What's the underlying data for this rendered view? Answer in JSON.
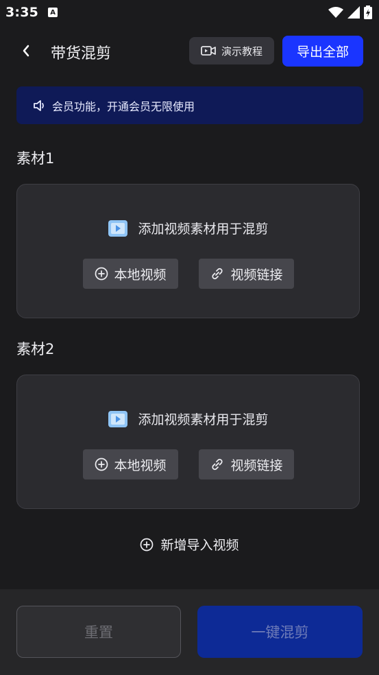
{
  "status_bar": {
    "time": "3:35",
    "notification_icon": "a-icon"
  },
  "header": {
    "title": "带货混剪",
    "tutorial_label": "演示教程",
    "export_label": "导出全部"
  },
  "vip_banner": {
    "text": "会员功能，开通会员无限使用"
  },
  "materials": [
    {
      "label": "素材1",
      "hint": "添加视频素材用于混剪",
      "local_label": "本地视频",
      "link_label": "视频链接"
    },
    {
      "label": "素材2",
      "hint": "添加视频素材用于混剪",
      "local_label": "本地视频",
      "link_label": "视频链接"
    }
  ],
  "add_video_label": "新增导入视频",
  "footer": {
    "reset_label": "重置",
    "mix_label": "一键混剪"
  },
  "colors": {
    "accent": "#1a35ff",
    "banner": "#0f1a57",
    "disabled_primary": "#0d2a96"
  }
}
